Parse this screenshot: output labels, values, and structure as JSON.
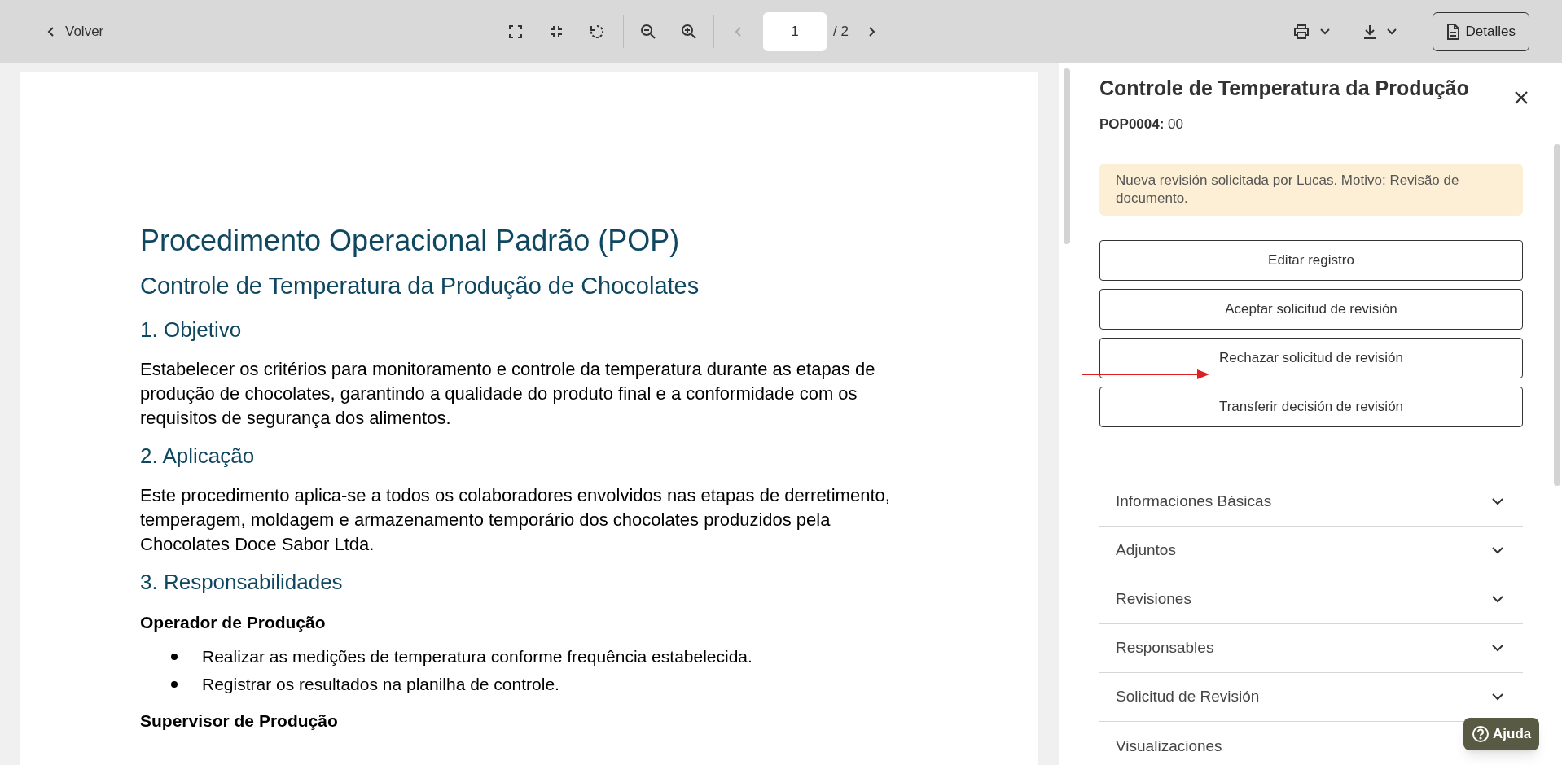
{
  "toolbar": {
    "back_label": "Volver",
    "page_input": {
      "value": "1"
    },
    "page_total": "/ 2",
    "prev_disabled": true,
    "next_disabled": false,
    "details_button": "Detalles"
  },
  "document": {
    "blocks": [
      {
        "kind": "title",
        "text": "Procedimento Operacional Padrão (POP)"
      },
      {
        "kind": "subtitle",
        "text": "Controle de Temperatura da Produção de Chocolates"
      },
      {
        "kind": "heading",
        "text": "1. Objetivo"
      },
      {
        "kind": "paragraph",
        "text": "Estabelecer os critérios para monitoramento e controle da temperatura durante as etapas de produção de chocolates, garantindo a qualidade do produto final e a conformidade com os requisitos de segurança dos alimentos."
      },
      {
        "kind": "heading",
        "text": "2. Aplicação"
      },
      {
        "kind": "paragraph",
        "text": "Este procedimento aplica-se a todos os colaboradores envolvidos nas etapas de derretimento, temperagem, moldagem e armazenamento temporário dos chocolates produzidos pela Chocolates Doce Sabor Ltda."
      },
      {
        "kind": "heading",
        "text": "3. Responsabilidades"
      },
      {
        "kind": "role",
        "text": "Operador de Produção"
      },
      {
        "kind": "bullets",
        "items": [
          "Realizar as medições de temperatura conforme frequência estabelecida.",
          "Registrar os resultados na planilha de controle."
        ]
      },
      {
        "kind": "role",
        "text": "Supervisor de Produção"
      }
    ]
  },
  "panel": {
    "title": "Controle de Temperatura da Produção",
    "code": "**POP0004:** 00",
    "notice": "Nueva revisión solicitada por Lucas. Motivo: Revisão de documento.",
    "actions": [
      "Editar registro",
      "Aceptar solicitud de revisión",
      "Rechazar solicitud de revisión",
      "Transferir decisión de revisión"
    ],
    "sections": [
      {
        "label": "Informaciones Básicas"
      },
      {
        "label": "Adjuntos"
      },
      {
        "label": "Revisiones"
      },
      {
        "label": "Responsables"
      },
      {
        "label": "Solicitud de Revisión"
      },
      {
        "label": "Visualizaciones"
      }
    ],
    "help_button": "Ajuda"
  }
}
